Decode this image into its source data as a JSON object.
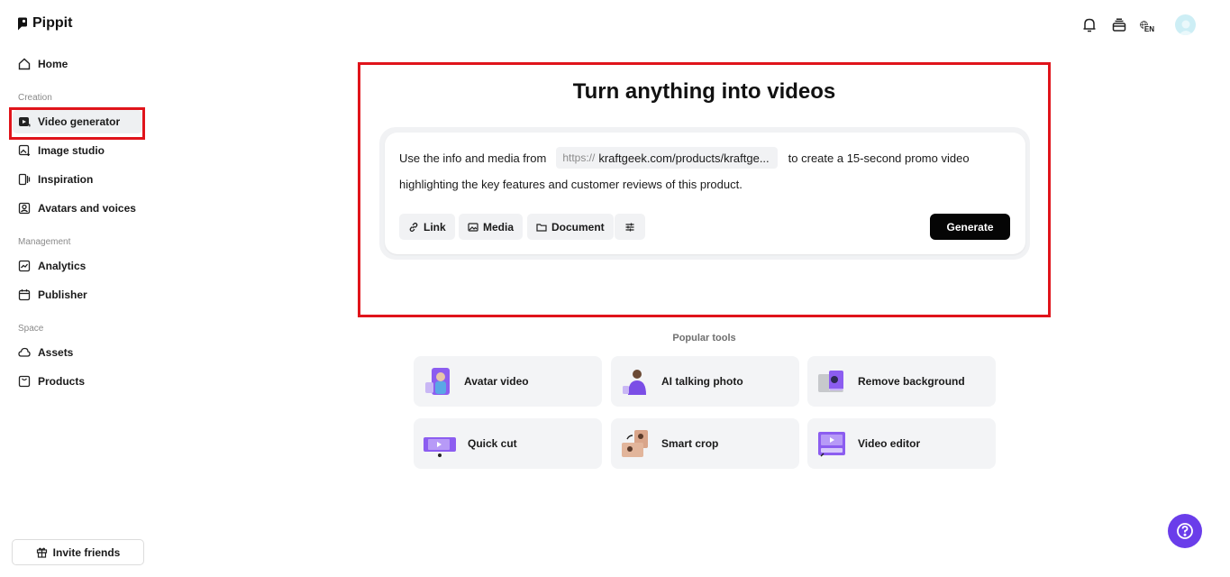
{
  "app": {
    "name": "Pippit"
  },
  "sidebar": {
    "home": "Home",
    "sections": {
      "creation": "Creation",
      "management": "Management",
      "space": "Space"
    },
    "items": {
      "video_generator": "Video generator",
      "image_studio": "Image studio",
      "inspiration": "Inspiration",
      "avatars_voices": "Avatars and voices",
      "analytics": "Analytics",
      "publisher": "Publisher",
      "assets": "Assets",
      "products": "Products"
    },
    "invite": "Invite friends"
  },
  "topbar": {
    "language": "EN"
  },
  "hero": {
    "title": "Turn anything into videos",
    "prompt_before": "Use the info and media from",
    "url_protocol": "https://",
    "url_host": "kraftgeek.com/products/kraftge...",
    "prompt_after": "to create a 15-second promo video",
    "prompt_line2": "highlighting the key features and customer reviews of this product.",
    "buttons": {
      "link": "Link",
      "media": "Media",
      "document": "Document",
      "generate": "Generate"
    }
  },
  "popular": {
    "label": "Popular tools",
    "tools": [
      "Avatar video",
      "AI talking photo",
      "Remove background",
      "Quick cut",
      "Smart crop",
      "Video editor"
    ]
  },
  "colors": {
    "accent": "#6a3dea",
    "highlight_outline": "#e0141b",
    "generate_bg": "#050505"
  }
}
